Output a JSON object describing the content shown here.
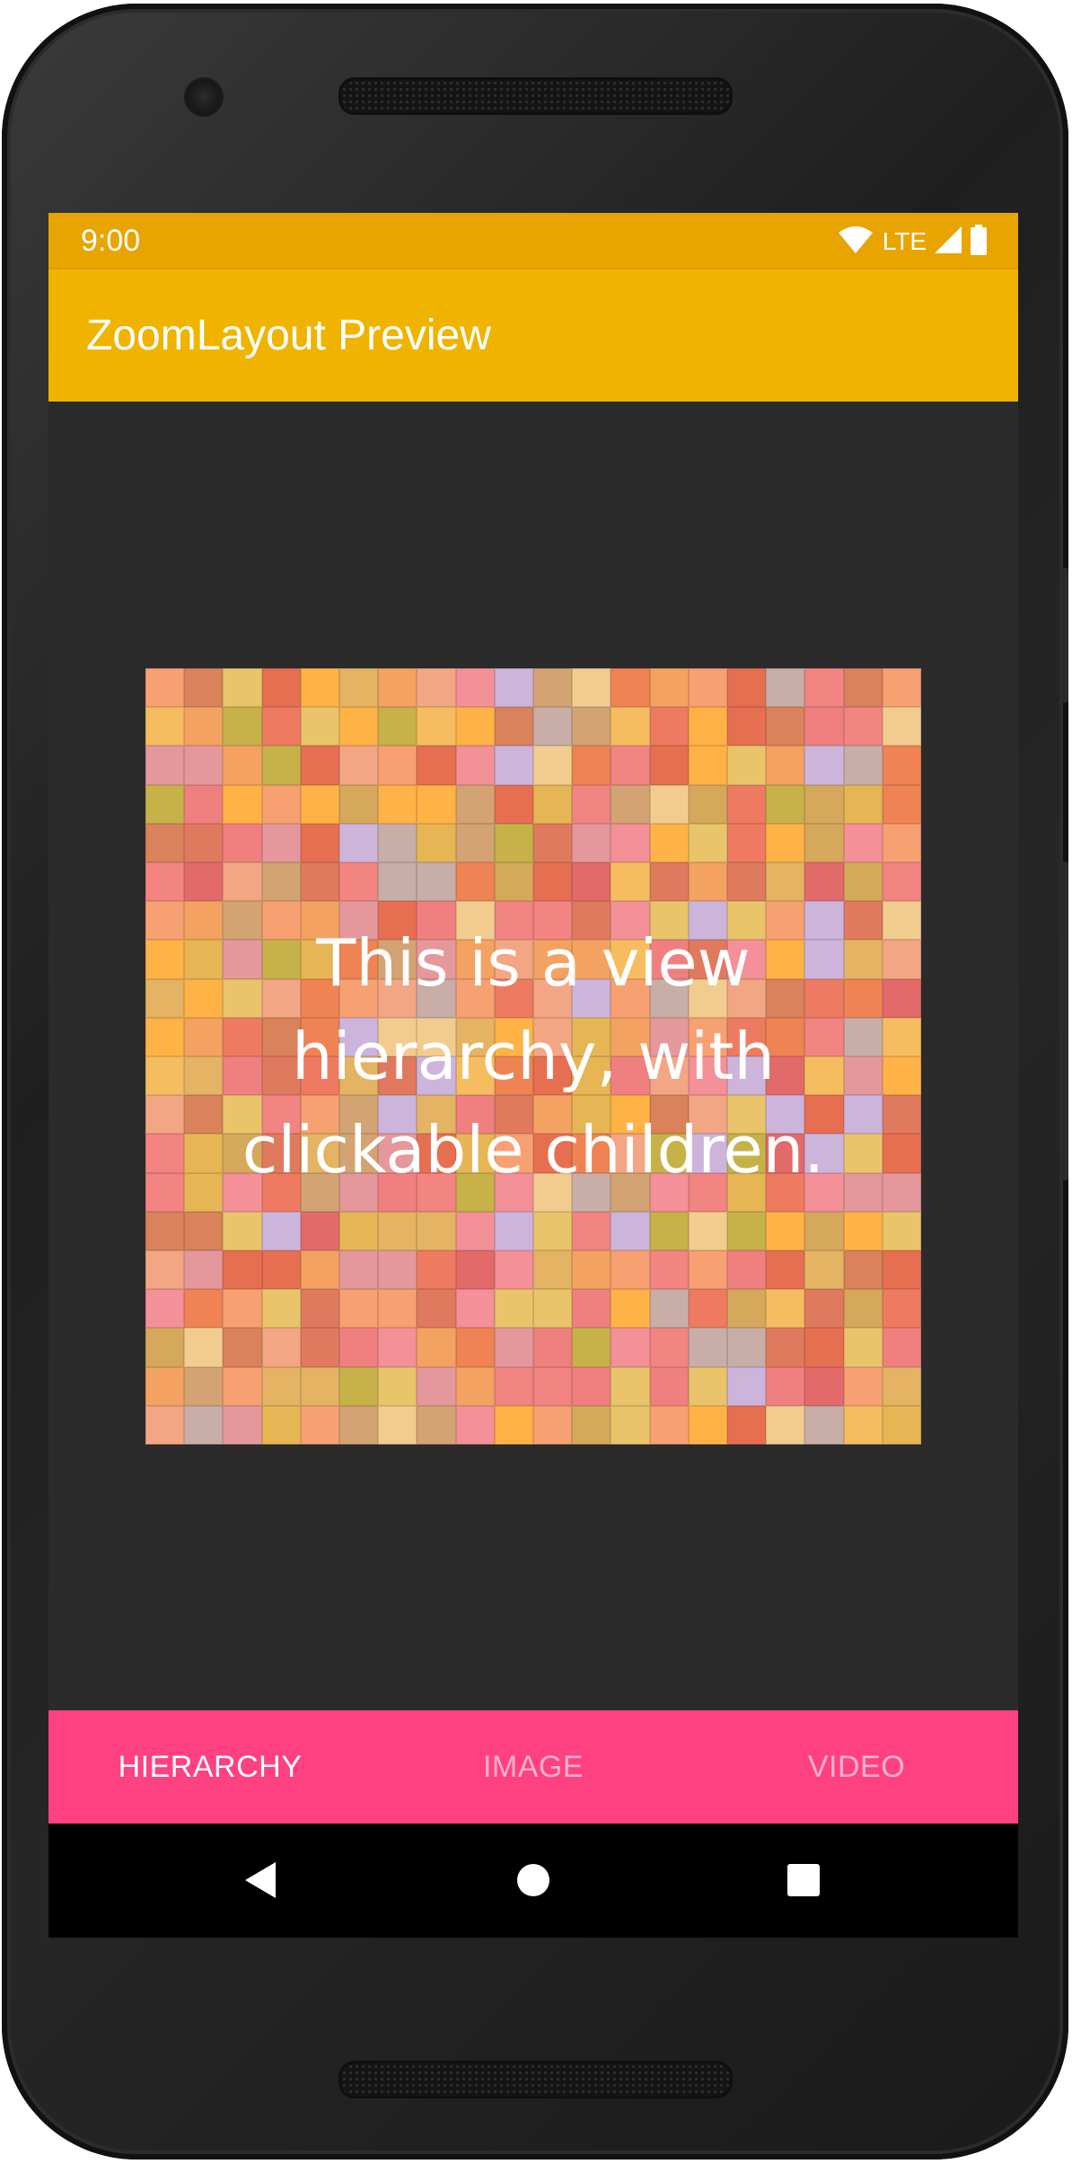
{
  "status_bar": {
    "time": "9:00",
    "network_label": "LTE",
    "icons": [
      "wifi-icon",
      "cellular-signal-icon",
      "battery-icon"
    ]
  },
  "app_bar": {
    "title": "ZoomLayout Preview",
    "color": "#efb300"
  },
  "content": {
    "overlay_text": "This is a view hierarchy, with clickable children."
  },
  "bottom_nav": {
    "color": "#ff4081",
    "tabs": [
      {
        "label": "HIERARCHY",
        "active": true
      },
      {
        "label": "IMAGE",
        "active": false
      },
      {
        "label": "VIDEO",
        "active": false
      }
    ]
  },
  "system_nav": {
    "buttons": [
      "back-icon",
      "home-icon",
      "recents-icon"
    ]
  },
  "mosaic_palette": [
    "#e07a5f",
    "#f4a261",
    "#e9c46a",
    "#f28482",
    "#f6bd60",
    "#e76f51",
    "#d4a373",
    "#f08080",
    "#e5989b",
    "#cdb4db",
    "#ffb347",
    "#f7a072",
    "#e4b363",
    "#d9825b",
    "#f49097",
    "#ef8354",
    "#c9ada7",
    "#e6b655",
    "#f2cc8f",
    "#e36a6a",
    "#d6a85c",
    "#f3a683",
    "#c7b24a",
    "#ee7b61"
  ]
}
